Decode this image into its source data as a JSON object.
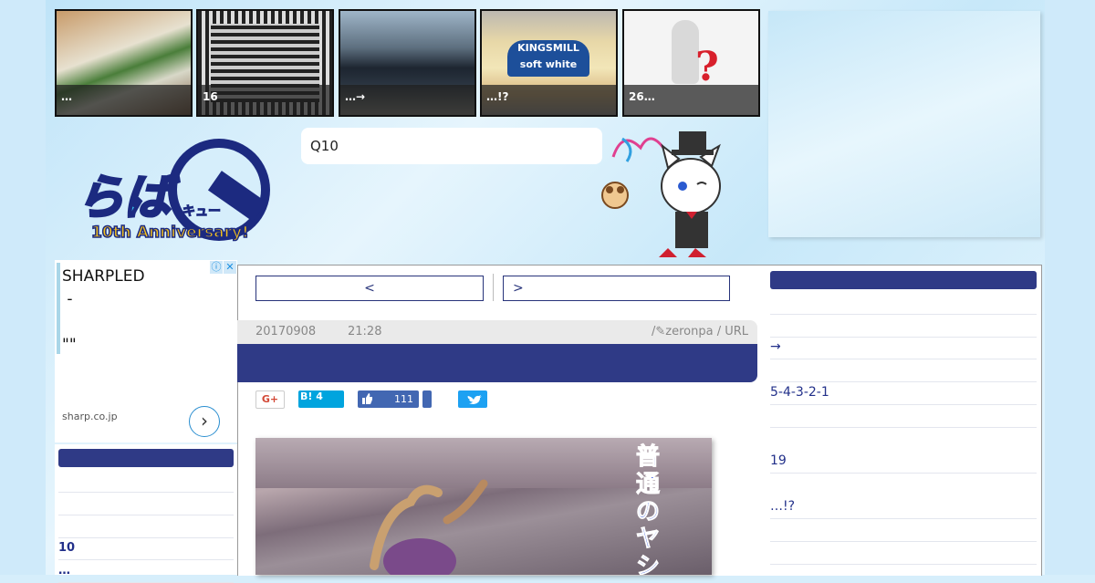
{
  "colors": {
    "navy": "#2f3a86",
    "page_bg": "#d6eefb",
    "hatena": "#00a4de",
    "facebook": "#4267b2",
    "twitter": "#1da1f2"
  },
  "thumbnails": [
    {
      "caption": "…"
    },
    {
      "caption": "16"
    },
    {
      "caption": "…→"
    },
    {
      "caption": "…!?",
      "package_text": "KINGSMILL soft white"
    },
    {
      "caption": "26…"
    }
  ],
  "header": {
    "search_text": "Q10",
    "logo_icon": "rabaq-10th-anniversary-logo",
    "mascot_icon": "cat-mascot-icon"
  },
  "ad": {
    "text": "SHARPLED\n -\n\n\"\"",
    "domain": "sharp.co.jp",
    "arrow_icon": "chevron-right-icon",
    "info_icon": "ⓘ",
    "close_icon": "✕"
  },
  "left_sidebar": {
    "rows": [
      "",
      "",
      "",
      "10",
      "…"
    ]
  },
  "article": {
    "prev_label": "<",
    "next_label": ">",
    "date": "20170908",
    "time": "21:28",
    "meta_right": "/✎zeronpa / URL",
    "share": {
      "gplus": "G+",
      "hatena": "B! 4",
      "facebook_count": "111"
    },
    "image_caption": "普通のヤシ"
  },
  "right_sidebar": {
    "rows": [
      "",
      "",
      "→",
      "",
      "5-4-3-2-1",
      "",
      "19",
      "…!?",
      "",
      ""
    ]
  }
}
